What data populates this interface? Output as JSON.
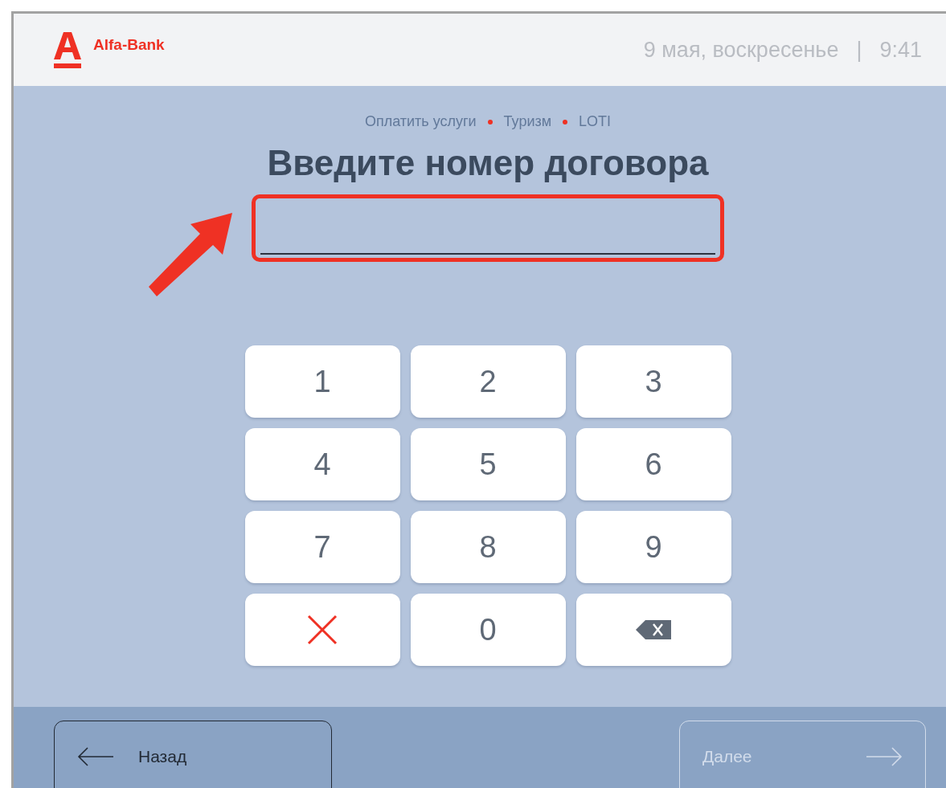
{
  "header": {
    "logo_text": "Alfa-Bank",
    "date": "9 мая, воскресенье",
    "separator": "|",
    "time": "9:41"
  },
  "breadcrumbs": [
    "Оплатить услуги",
    "Туризм",
    "LOTI"
  ],
  "title": "Введите номер договора",
  "field": {
    "highlighted": true
  },
  "keypad": [
    {
      "kind": "digit",
      "label": "1"
    },
    {
      "kind": "digit",
      "label": "2"
    },
    {
      "kind": "digit",
      "label": "3"
    },
    {
      "kind": "digit",
      "label": "4"
    },
    {
      "kind": "digit",
      "label": "5"
    },
    {
      "kind": "digit",
      "label": "6"
    },
    {
      "kind": "digit",
      "label": "7"
    },
    {
      "kind": "digit",
      "label": "8"
    },
    {
      "kind": "digit",
      "label": "9"
    },
    {
      "kind": "cancel"
    },
    {
      "kind": "digit",
      "label": "0"
    },
    {
      "kind": "backspace"
    }
  ],
  "footer": {
    "back": {
      "label": "Назад",
      "disabled": false
    },
    "next": {
      "label": "Далее",
      "disabled": true
    }
  }
}
